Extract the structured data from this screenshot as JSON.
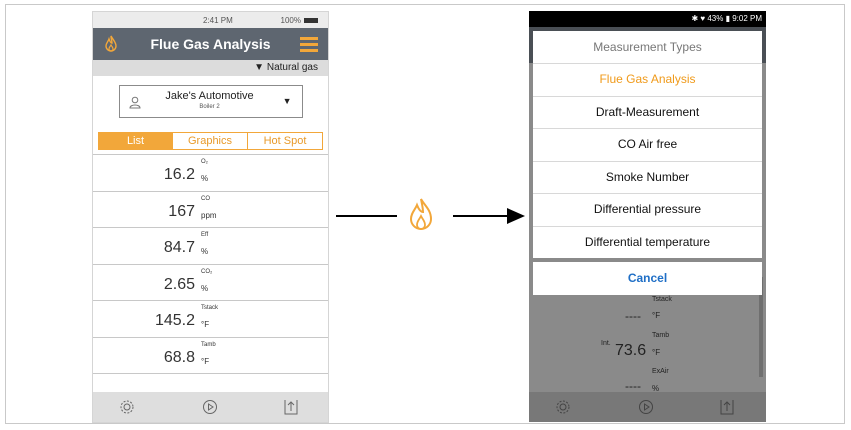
{
  "left_screen": {
    "status": {
      "time": "2:41 PM",
      "battery": "100%"
    },
    "title": "Flue Gas Analysis",
    "fuel": "▼ Natural gas",
    "customer": {
      "name": "Jake's Automotive",
      "sub": "Boiler 2"
    },
    "tabs": [
      "List",
      "Graphics",
      "Hot Spot"
    ],
    "rows": [
      {
        "label": "O₂",
        "value": "16.2",
        "unit": "%"
      },
      {
        "label": "CO",
        "value": "167",
        "unit": "ppm"
      },
      {
        "label": "Eff",
        "value": "84.7",
        "unit": "%"
      },
      {
        "label": "CO₂",
        "value": "2.65",
        "unit": "%"
      },
      {
        "label": "Tstack",
        "value": "145.2",
        "unit": "°F"
      },
      {
        "label": "Tamb",
        "value": "68.8",
        "unit": "°F"
      }
    ]
  },
  "right_screen": {
    "status": "✱ ♥ 43% ▮ 9:02 PM",
    "dialog": {
      "header": "Measurement Types",
      "items": [
        "Flue Gas Analysis",
        "Draft-Measurement",
        "CO Air free",
        "Smoke Number",
        "Differential pressure",
        "Differential temperature"
      ],
      "cancel": "Cancel"
    },
    "background_rows": [
      {
        "prefix": "",
        "label": "Tstack",
        "value": "----",
        "unit": "°F"
      },
      {
        "prefix": "Int.",
        "label": "Tamb",
        "value": "73.6",
        "unit": "°F"
      },
      {
        "prefix": "",
        "label": "ExAir",
        "value": "----",
        "unit": "%"
      }
    ]
  },
  "colors": {
    "accent": "#f2a73a",
    "header": "#5e6670",
    "link": "#1f6fc6"
  }
}
